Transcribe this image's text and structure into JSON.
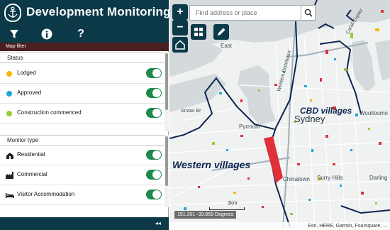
{
  "app": {
    "title": "Development Monitoring"
  },
  "toolbar": {
    "filter_icon": "filter-icon",
    "info_icon": "info-icon",
    "help_icon": "help-icon"
  },
  "map_filter": {
    "label": "Map filter"
  },
  "status": {
    "header": "Status",
    "items": [
      {
        "label": "Lodged",
        "color": "#f5b800",
        "on": true
      },
      {
        "label": "Approved",
        "color": "#1fa6d9",
        "on": true
      },
      {
        "label": "Construction commenced",
        "color": "#9acd32",
        "on": true
      }
    ]
  },
  "monitor_type": {
    "header": "Monitor type",
    "items": [
      {
        "label": "Residential",
        "icon": "house-icon",
        "on": true
      },
      {
        "label": "Commercial",
        "icon": "factory-icon",
        "on": true
      },
      {
        "label": "Visitor Accommodation",
        "icon": "bed-icon",
        "on": true
      }
    ]
  },
  "collapse": {
    "label": "◂◂"
  },
  "map": {
    "zoom_in": "+",
    "zoom_out": "−",
    "search_placeholder": "Find address or place",
    "labels": {
      "east": "East",
      "anzac": "Anzac Br",
      "pyrmont": "Pyrmont",
      "sydney": "Sydney",
      "chinatown": "Chinatown",
      "surry_hills": "Surry Hills",
      "darling": "Darling",
      "woolloomooloo": "Woolloomo",
      "western_distributor": "Western Distributor",
      "cahill": "Cahill Expwy"
    },
    "cbd_label": "CBD villages",
    "western_label": "Western villages",
    "scale_label": "1km",
    "coords": "151.201 -33.869 Degrees",
    "attribution": "Esri, HERE, Garmin, Foursquare, ..."
  }
}
